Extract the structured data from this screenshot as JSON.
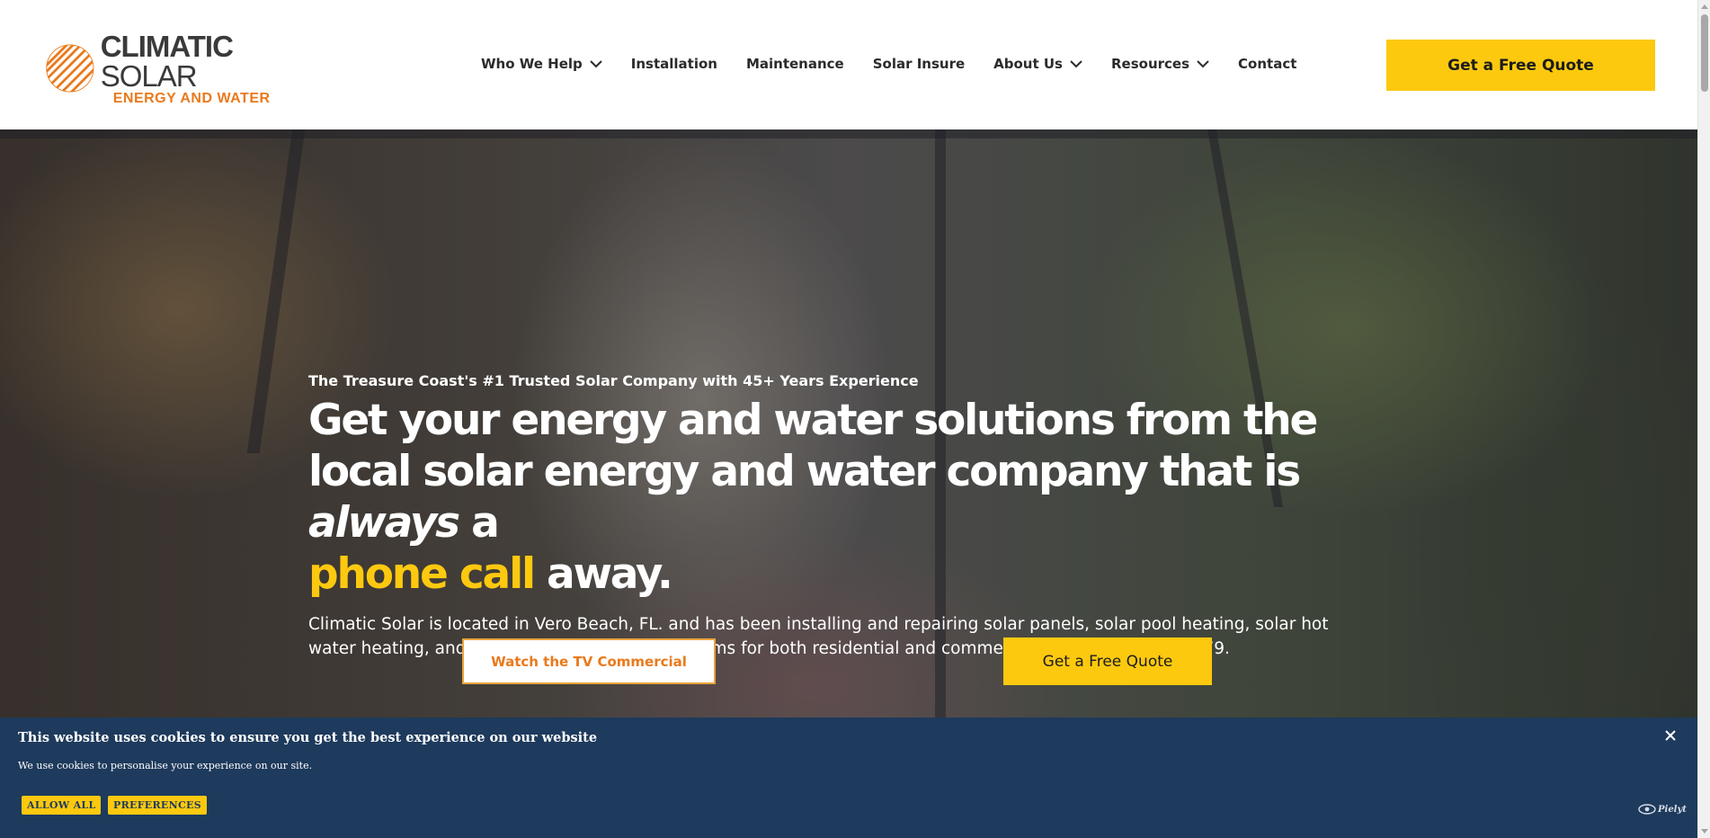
{
  "header": {
    "logo": {
      "name_bold": "CLIMATIC",
      "name_thin": "SOLAR",
      "tagline": "ENERGY AND WATER"
    },
    "nav": [
      {
        "label": "Who We Help",
        "has_dropdown": true
      },
      {
        "label": "Installation",
        "has_dropdown": false
      },
      {
        "label": "Maintenance",
        "has_dropdown": false
      },
      {
        "label": "Solar Insure",
        "has_dropdown": false
      },
      {
        "label": "About Us",
        "has_dropdown": true
      },
      {
        "label": "Resources",
        "has_dropdown": true
      },
      {
        "label": "Contact",
        "has_dropdown": false
      }
    ],
    "cta_label": "Get a Free Quote"
  },
  "hero": {
    "eyebrow": "The Treasure Coast's #1 Trusted Solar Company with 45+ Years Experience",
    "title_part1": "Get your energy and water solutions from the local solar energy and water company that is ",
    "title_em": "always",
    "title_part2": " a ",
    "title_highlight": "phone call",
    "title_part3": " away.",
    "description": "Climatic Solar is located in Vero Beach, FL. and has been installing and repairing solar panels, solar pool heating, solar hot water heating, and complete solar electric systems for both residential and commercial properties since 1979.",
    "tv_button_label": "Watch the TV Commercial",
    "quote_button_label": "Get a Free Quote"
  },
  "cookie_banner": {
    "title": "This website uses cookies to ensure you get the best experience on our website",
    "text": "We use cookies to personalise your experience on our site.",
    "allow_all_label": "ALLOW ALL",
    "preferences_label": "PREFERENCES",
    "brand": "Pielyt"
  },
  "colors": {
    "accent_yellow": "#fdc90f",
    "brand_orange": "#e97a1c",
    "banner_navy": "#1e3a5c"
  },
  "icons": [
    "logo-sun-icon",
    "chevron-down-icon",
    "close-icon",
    "eye-icon"
  ]
}
